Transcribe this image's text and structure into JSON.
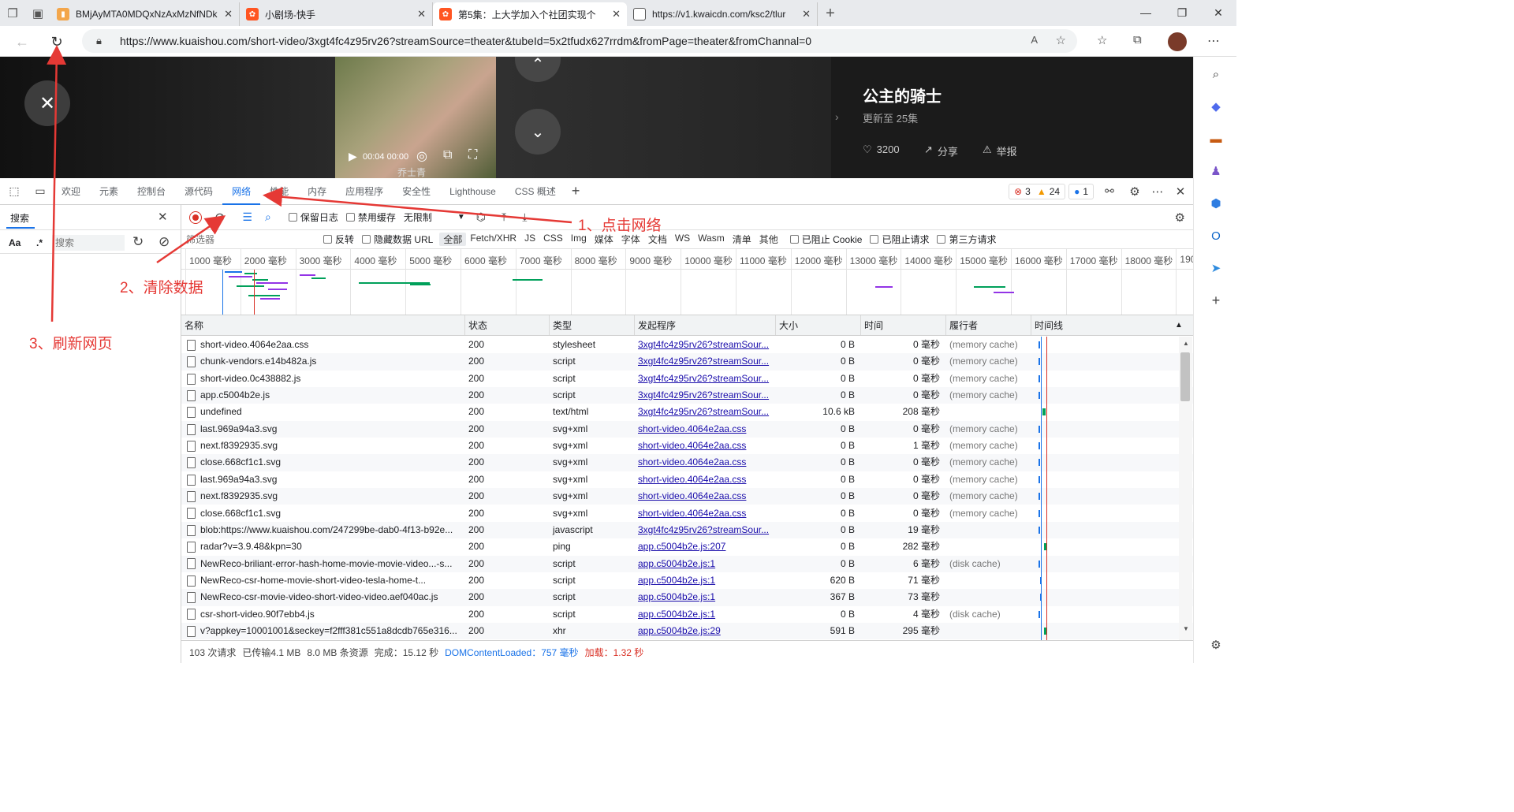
{
  "tabs": [
    {
      "title": "BMjAyMTA0MDQxNzAxMzNfNDk",
      "fav_color": "#f3a64b"
    },
    {
      "title": "小剧场-快手",
      "fav_color": "#ff5522"
    },
    {
      "title": "第5集：上大学加入个社团实现个",
      "fav_color": "#ff5522"
    },
    {
      "title": "https://v1.kwaicdn.com/ksc2/tlur",
      "fav_color": "#ffffff"
    }
  ],
  "address": {
    "url": "https://www.kuaishou.com/short-video/3xgt4fc4z95rv26?streamSource=theater&tubeId=5x2tfudx627rrdm&fromPage=theater&fromChannal=0"
  },
  "video": {
    "title": "公主的骑士",
    "subtitle": "更新至 25集",
    "likes": "3200",
    "share": "分享",
    "report": "举报",
    "time": "00:04 00:00",
    "caption": "乔士青"
  },
  "devtools": {
    "tabs": [
      "欢迎",
      "元素",
      "控制台",
      "源代码",
      "网络",
      "性能",
      "内存",
      "应用程序",
      "安全性",
      "Lighthouse",
      "CSS 概述"
    ],
    "errors": "3",
    "warnings": "24",
    "infos": "1"
  },
  "search": {
    "tab": "搜索",
    "aa": "Aa",
    "regex": ".*",
    "placeholder": "搜索"
  },
  "toolbar": {
    "preserve_log": "保留日志",
    "disable_cache": "禁用缓存",
    "throttle": "无限制"
  },
  "filter": {
    "placeholder": "筛选器",
    "invert": "反转",
    "hide_data_url": "隐藏数据 URL",
    "types": [
      "全部",
      "Fetch/XHR",
      "JS",
      "CSS",
      "Img",
      "媒体",
      "字体",
      "文档",
      "WS",
      "Wasm",
      "清单",
      "其他"
    ],
    "blocked_cookies": "已阻止 Cookie",
    "blocked_requests": "已阻止请求",
    "third_party": "第三方请求"
  },
  "overview_ticks": [
    "1000 毫秒",
    "2000 毫秒",
    "3000 毫秒",
    "4000 毫秒",
    "5000 毫秒",
    "6000 毫秒",
    "7000 毫秒",
    "8000 毫秒",
    "9000 毫秒",
    "10000 毫秒",
    "11000 毫秒",
    "12000 毫秒",
    "13000 毫秒",
    "14000 毫秒",
    "15000 毫秒",
    "16000 毫秒",
    "17000 毫秒",
    "18000 毫秒",
    "190"
  ],
  "columns": [
    "名称",
    "状态",
    "类型",
    "发起程序",
    "大小",
    "时间",
    "履行者",
    "时间线"
  ],
  "rows": [
    {
      "name": "short-video.4064e2aa.css",
      "status": "200",
      "type": "stylesheet",
      "initiator": "3xgt4fc4z95rv26?streamSour...",
      "size": "0 B",
      "time": "0",
      "fulfilled": "(memory cache)"
    },
    {
      "name": "chunk-vendors.e14b482a.js",
      "status": "200",
      "type": "script",
      "initiator": "3xgt4fc4z95rv26?streamSour...",
      "size": "0 B",
      "time": "0",
      "fulfilled": "(memory cache)"
    },
    {
      "name": "short-video.0c438882.js",
      "status": "200",
      "type": "script",
      "initiator": "3xgt4fc4z95rv26?streamSour...",
      "size": "0 B",
      "time": "0",
      "fulfilled": "(memory cache)"
    },
    {
      "name": "app.c5004b2e.js",
      "status": "200",
      "type": "script",
      "initiator": "3xgt4fc4z95rv26?streamSour...",
      "size": "0 B",
      "time": "0",
      "fulfilled": "(memory cache)"
    },
    {
      "name": "undefined",
      "status": "200",
      "type": "text/html",
      "initiator": "3xgt4fc4z95rv26?streamSour...",
      "size": "10.6 kB",
      "time": "208",
      "fulfilled": ""
    },
    {
      "name": "last.969a94a3.svg",
      "status": "200",
      "type": "svg+xml",
      "initiator": "short-video.4064e2aa.css",
      "size": "0 B",
      "time": "0",
      "fulfilled": "(memory cache)"
    },
    {
      "name": "next.f8392935.svg",
      "status": "200",
      "type": "svg+xml",
      "initiator": "short-video.4064e2aa.css",
      "size": "0 B",
      "time": "1",
      "fulfilled": "(memory cache)"
    },
    {
      "name": "close.668cf1c1.svg",
      "status": "200",
      "type": "svg+xml",
      "initiator": "short-video.4064e2aa.css",
      "size": "0 B",
      "time": "0",
      "fulfilled": "(memory cache)"
    },
    {
      "name": "last.969a94a3.svg",
      "status": "200",
      "type": "svg+xml",
      "initiator": "short-video.4064e2aa.css",
      "size": "0 B",
      "time": "0",
      "fulfilled": "(memory cache)"
    },
    {
      "name": "next.f8392935.svg",
      "status": "200",
      "type": "svg+xml",
      "initiator": "short-video.4064e2aa.css",
      "size": "0 B",
      "time": "0",
      "fulfilled": "(memory cache)"
    },
    {
      "name": "close.668cf1c1.svg",
      "status": "200",
      "type": "svg+xml",
      "initiator": "short-video.4064e2aa.css",
      "size": "0 B",
      "time": "0",
      "fulfilled": "(memory cache)"
    },
    {
      "name": "blob:https://www.kuaishou.com/247299be-dab0-4f13-b92e...",
      "status": "200",
      "type": "javascript",
      "initiator": "3xgt4fc4z95rv26?streamSour...",
      "size": "0 B",
      "time": "19",
      "fulfilled": ""
    },
    {
      "name": "radar?v=3.9.48&kpn=30",
      "status": "200",
      "type": "ping",
      "initiator": "app.c5004b2e.js:207",
      "size": "0 B",
      "time": "282",
      "fulfilled": ""
    },
    {
      "name": "NewReco-briliant-error-hash-home-movie-movie-video...-s...",
      "status": "200",
      "type": "script",
      "initiator": "app.c5004b2e.js:1",
      "size": "0 B",
      "time": "6",
      "fulfilled": "(disk cache)"
    },
    {
      "name": "NewReco-csr-home-movie-short-video-tesla-home-t...",
      "status": "200",
      "type": "script",
      "initiator": "app.c5004b2e.js:1",
      "size": "620 B",
      "time": "71",
      "fulfilled": ""
    },
    {
      "name": "NewReco-csr-movie-video-short-video-video.aef040ac.js",
      "status": "200",
      "type": "script",
      "initiator": "app.c5004b2e.js:1",
      "size": "367 B",
      "time": "73",
      "fulfilled": ""
    },
    {
      "name": "csr-short-video.90f7ebb4.js",
      "status": "200",
      "type": "script",
      "initiator": "app.c5004b2e.js:1",
      "size": "0 B",
      "time": "4",
      "fulfilled": "(disk cache)"
    },
    {
      "name": "v?appkey=10001001&seckey=f2fff381c551a8dcdb765e316...",
      "status": "200",
      "type": "xhr",
      "initiator": "app.c5004b2e.js:29",
      "size": "591 B",
      "time": "295",
      "fulfilled": ""
    }
  ],
  "time_unit": "毫秒",
  "status": {
    "requests": "103 次请求",
    "transferred": "已传输4.1 MB",
    "resources": "8.0 MB 条资源",
    "finish": "完成：15.12 秒",
    "dcl": "DOMContentLoaded：757 毫秒",
    "load": "加载：1.32 秒"
  },
  "annotations": {
    "step1": "1、点击网络",
    "step2": "2、清除数据",
    "step3": "3、刷新网页"
  },
  "colors": {
    "annotation": "#e53935",
    "accent": "#1a73e8",
    "link": "#1a0dab"
  }
}
